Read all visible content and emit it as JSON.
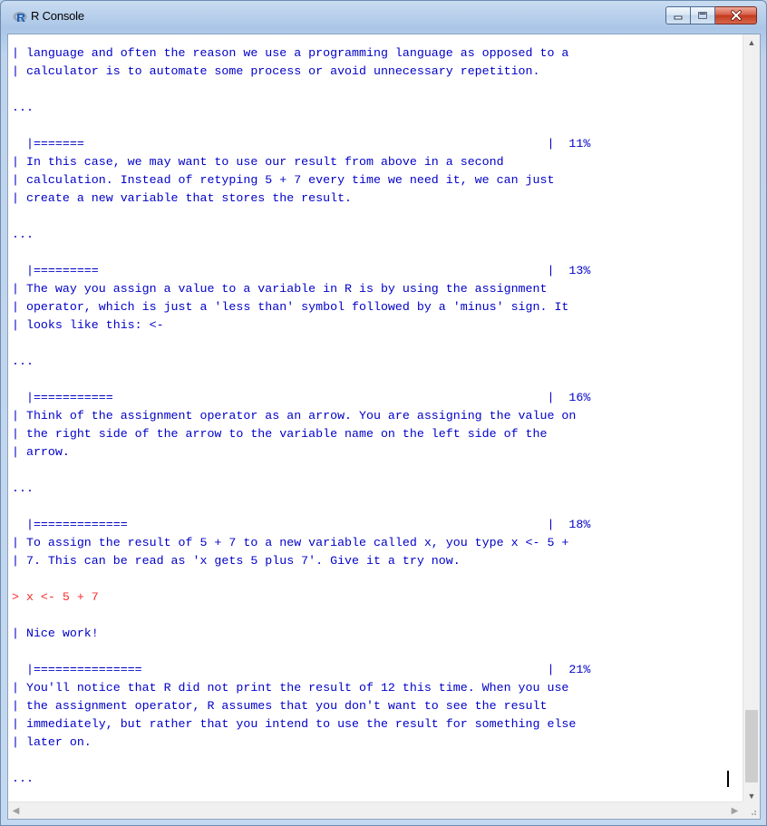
{
  "window": {
    "title": "R Console"
  },
  "console": {
    "lines": [
      "| language and often the reason we use a programming language as opposed to a",
      "| calculator is to automate some process or avoid unnecessary repetition.",
      "",
      "...",
      "",
      "  |=======                                                                |  11%",
      "| In this case, we may want to use our result from above in a second",
      "| calculation. Instead of retyping 5 + 7 every time we need it, we can just",
      "| create a new variable that stores the result.",
      "",
      "...",
      "",
      "  |=========                                                              |  13%",
      "| The way you assign a value to a variable in R is by using the assignment",
      "| operator, which is just a 'less than' symbol followed by a 'minus' sign. It",
      "| looks like this: <-",
      "",
      "...",
      "",
      "  |===========                                                            |  16%",
      "| Think of the assignment operator as an arrow. You are assigning the value on",
      "| the right side of the arrow to the variable name on the left side of the",
      "| arrow.",
      "",
      "...",
      "",
      "  |=============                                                          |  18%",
      "| To assign the result of 5 + 7 to a new variable called x, you type x <- 5 +",
      "| 7. This can be read as 'x gets 5 plus 7'. Give it a try now.",
      "",
      "> x <- 5 + 7",
      "",
      "| Nice work!",
      "",
      "  |===============                                                        |  21%",
      "| You'll notice that R did not print the result of 12 this time. When you use",
      "| the assignment operator, R assumes that you don't want to see the result",
      "| immediately, but rather that you intend to use the result for something else",
      "| later on.",
      "",
      "..."
    ],
    "input_line_index": 30
  },
  "colors": {
    "output_text": "#0000c8",
    "input_text": "#ff2a2a"
  },
  "icons": {
    "app": "r-logo-icon",
    "minimize": "minimize-icon",
    "maximize": "maximize-icon",
    "close": "close-icon",
    "scroll_up": "scroll-up-arrow-icon",
    "scroll_down": "scroll-down-arrow-icon",
    "scroll_left": "scroll-left-arrow-icon",
    "scroll_right": "scroll-right-arrow-icon"
  }
}
